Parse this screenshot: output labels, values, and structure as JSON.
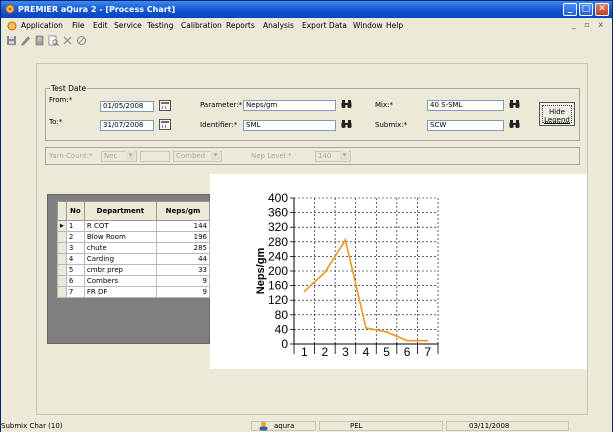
{
  "window": {
    "title": "PREMIER aQura 2 - [Process Chart]",
    "minimize": "_",
    "maximize": "□",
    "close": "✕"
  },
  "menu": {
    "items": [
      "Application",
      "File",
      "Edit",
      "Service",
      "Testing",
      "Calibration",
      "Reports",
      "Analysis",
      "Export Data",
      "Window",
      "Help"
    ],
    "child_controls": "_ ▫ x"
  },
  "toolbar": {
    "icons": [
      "save-icon",
      "edit-icon",
      "delete-icon",
      "print-preview-icon",
      "cancel-x-icon",
      "stop-icon"
    ]
  },
  "filters": {
    "group_title": "Test Date",
    "from_label": "From:*",
    "from_value": "01/05/2008",
    "to_label": "To:*",
    "to_value": "31/07/2008",
    "parameter_label": "Parameter:*",
    "parameter_value": "Neps/gm",
    "identifier_label": "Identifier:*",
    "identifier_value": "SML",
    "mix_label": "Mix:*",
    "mix_value": "40 S-SML",
    "submix_label": "Submix:*",
    "submix_value": "SCW",
    "hide_legend_label_1": "Hide",
    "hide_legend_label_2": "Legend"
  },
  "yarn_row": {
    "yarn_count_label": "Yarn Count:*",
    "yarn_count_value": "Nec",
    "combed_value": "Combed",
    "nep_level_label": "Nep Level:*",
    "nep_level_value": "140"
  },
  "grid": {
    "headers": [
      "No",
      "Department",
      "Neps/gm"
    ],
    "rows": [
      {
        "no": "1",
        "dept": "R COT",
        "value": "144",
        "selected": true
      },
      {
        "no": "2",
        "dept": "Blow Room",
        "value": "196"
      },
      {
        "no": "3",
        "dept": "chute",
        "value": "285"
      },
      {
        "no": "4",
        "dept": "Carding",
        "value": "44"
      },
      {
        "no": "5",
        "dept": "cmbr prep",
        "value": "33"
      },
      {
        "no": "6",
        "dept": "Combers",
        "value": "9"
      },
      {
        "no": "7",
        "dept": "FR DF",
        "value": "9"
      }
    ]
  },
  "chart_data": {
    "type": "line",
    "title": "",
    "xlabel": "",
    "ylabel": "Neps/gm",
    "x": [
      1,
      2,
      3,
      4,
      5,
      6,
      7
    ],
    "series": [
      {
        "values": [
          144,
          196,
          285,
          44,
          33,
          9,
          9
        ],
        "color": "#f0961e"
      }
    ],
    "ylim": [
      0,
      400
    ],
    "yticks": [
      0,
      40,
      80,
      120,
      160,
      200,
      240,
      280,
      320,
      360,
      400
    ],
    "xticks": [
      1,
      2,
      3,
      4,
      5,
      6,
      7
    ],
    "grid": true
  },
  "status": {
    "left": "Submix Char (10)",
    "user": "aqura",
    "company": "PEL",
    "date": "03/11/2008"
  }
}
